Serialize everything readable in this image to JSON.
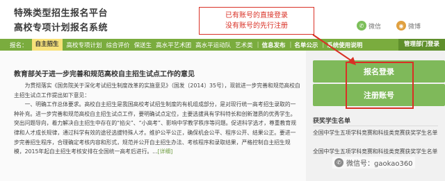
{
  "header": {
    "title_line1": "特殊类型招生报名平台",
    "title_line2": "高校专项计划报名系统",
    "weixin_label": "微信",
    "weibo_label": "微博",
    "weixin_icon": "wechat-icon",
    "weibo_icon": "weibo-icon"
  },
  "nav": {
    "prefix": "报名：",
    "items": [
      "自主招生",
      "高校专项计划",
      "综合评价",
      "保送生",
      "高水平艺术团",
      "高水平运动队",
      "艺术类",
      "信息发布",
      "名单公示",
      "系统使用说明"
    ],
    "sep": "|",
    "admin": "管理部门登录"
  },
  "article": {
    "title": "教育部关于进一步完善和规范高校自主招生试点工作的意见",
    "p1": "为贯彻落实《国务院关于深化考试招生制度改革的实施意见》（国发〔2014〕35号），现就进一步完善和规范高校自主招生试点工作提出如下意见：",
    "p2": "一、明确工作总体要求。高校自主招生是我国高校考试招生制度的有机组成部分，是对现行统一高考招生录取的一种补充。进一步完善和规范高校自主招生试点工作，要明确试点定位，主要选拔具有学科特长和创新潜质的优秀学生。突出问题导向，着力解决自主招生中存在的“掐尖”、“小高考”、影响中学教学秩序等问题。促进科学选才，尊重教育规律和人才成长规律，通过科学有效的途径选拔特殊人才。维护公平公正，确保机会公平、程序公开、结果公正。要进一步完善招生程序，合理确定考核内容和形式，规范并公开自主招生办法、考核程序和录取结果，严格控制自主招生规模，2015年起自主招生考核安排在全国统一高考后进行。...",
    "detail": "[详细]"
  },
  "sidebar": {
    "login_button": "报名登录",
    "register_button": "注册账号",
    "list_title": "获奖学生名单",
    "items": [
      "全国中学生五项学科竞赛和科技类竞赛获奖学生名单",
      "全国中学生五项学科竞赛和科技类竞赛获奖学生名单"
    ]
  },
  "annotation": {
    "line1": "已有账号的直接登录",
    "line2": "没有账号的先行注册"
  },
  "watermark": {
    "text": "微信号：gaokao360",
    "icon": "wechat-icon"
  },
  "colors": {
    "nav_green": "#7aac3e",
    "button_green": "#7fb95a",
    "annotation_red": "#d93025",
    "active_tab": "#f7e27a"
  }
}
